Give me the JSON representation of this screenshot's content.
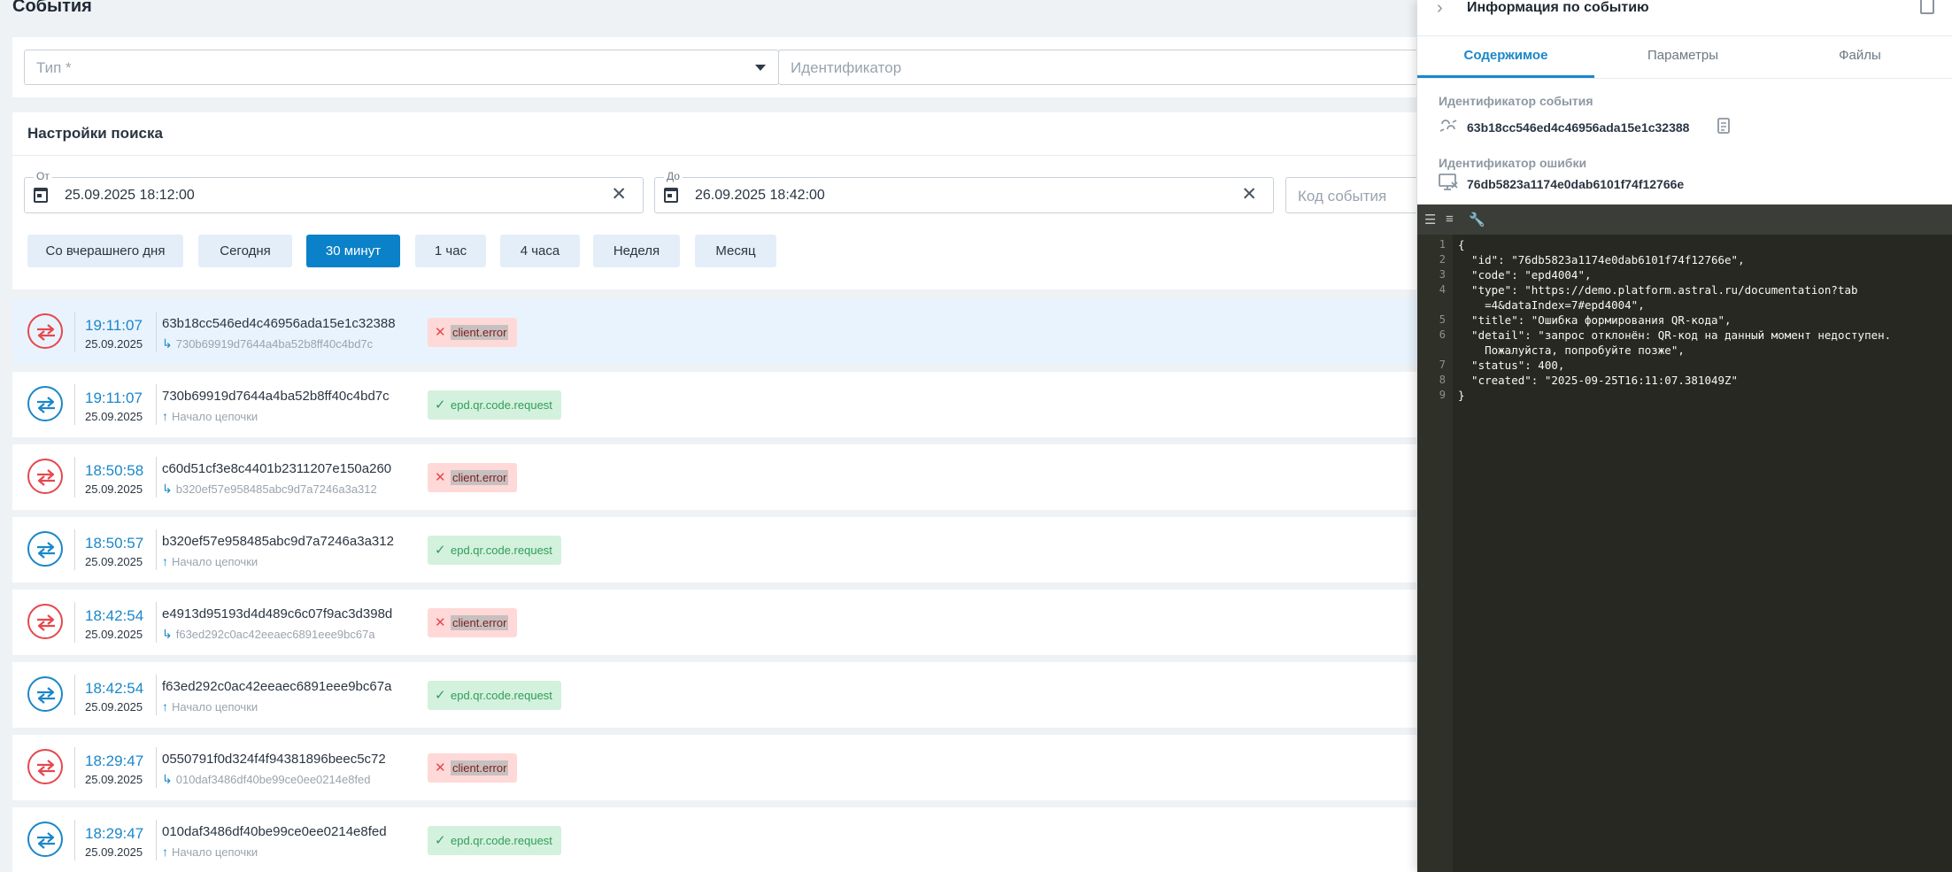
{
  "page": {
    "title": "События"
  },
  "filters": {
    "type_placeholder": "Тип *",
    "id_placeholder": "Идентификатор"
  },
  "search": {
    "title": "Настройки поиска",
    "from_label": "От",
    "from_value": "25.09.2025 18:12:00",
    "to_label": "До",
    "to_value": "26.09.2025 18:42:00",
    "code_placeholder": "Код события",
    "quick": [
      "Со вчерашнего дня",
      "Сегодня",
      "30 минут",
      "1 час",
      "4 часа",
      "Неделя",
      "Месяц"
    ],
    "active_quick": "30 минут"
  },
  "events": [
    {
      "status": "error",
      "time": "19:11:07",
      "date": "25.09.2025",
      "id": "63b18cc546ed4c46956ada15e1c32388",
      "sub": "730b69919d7644a4ba52b8ff40c4bd7c",
      "badge": "client.error"
    },
    {
      "status": "ok",
      "time": "19:11:07",
      "date": "25.09.2025",
      "id": "730b69919d7644a4ba52b8ff40c4bd7c",
      "sub": "Начало цепочки",
      "badge": "epd.qr.code.request"
    },
    {
      "status": "error",
      "time": "18:50:58",
      "date": "25.09.2025",
      "id": "c60d51cf3e8c4401b2311207e150a260",
      "sub": "b320ef57e958485abc9d7a7246a3a312",
      "badge": "client.error"
    },
    {
      "status": "ok",
      "time": "18:50:57",
      "date": "25.09.2025",
      "id": "b320ef57e958485abc9d7a7246a3a312",
      "sub": "Начало цепочки",
      "badge": "epd.qr.code.request"
    },
    {
      "status": "error",
      "time": "18:42:54",
      "date": "25.09.2025",
      "id": "e4913d95193d4d489c6c07f9ac3d398d",
      "sub": "f63ed292c0ac42eeaec6891eee9bc67a",
      "badge": "client.error"
    },
    {
      "status": "ok",
      "time": "18:42:54",
      "date": "25.09.2025",
      "id": "f63ed292c0ac42eeaec6891eee9bc67a",
      "sub": "Начало цепочки",
      "badge": "epd.qr.code.request"
    },
    {
      "status": "error",
      "time": "18:29:47",
      "date": "25.09.2025",
      "id": "0550791f0d324f4f94381896beec5c72",
      "sub": "010daf3486df40be99ce0ee0214e8fed",
      "badge": "client.error"
    },
    {
      "status": "ok",
      "time": "18:29:47",
      "date": "25.09.2025",
      "id": "010daf3486df40be99ce0ee0214e8fed",
      "sub": "Начало цепочки",
      "badge": "epd.qr.code.request"
    }
  ],
  "panel": {
    "title": "Информация по событию",
    "tabs": [
      "Содержимое",
      "Параметры",
      "Файлы"
    ],
    "event_id_label": "Идентификатор события",
    "event_id": "63b18cc546ed4c46956ada15e1c32388",
    "error_id_label": "Идентификатор ошибки",
    "error_id": "76db5823a1174e0dab6101f74f12766e",
    "code_lines": [
      "{",
      "  \"id\": \"76db5823a1174e0dab6101f74f12766e\",",
      "  \"code\": \"epd4004\",",
      "  \"type\": \"https://demo.platform.astral.ru/documentation?tab",
      "    =4&dataIndex=7#epd4004\",",
      "  \"title\": \"Ошибка формирования QR-кода\",",
      "  \"detail\": \"запрос отклонён: QR-код на данный момент недоступен.",
      "    Пожалуйста, попробуйте позже\",",
      "  \"status\": 400,",
      "  \"created\": \"2025-09-25T16:11:07.381049Z\"",
      "}"
    ],
    "line_numbers": [
      "1",
      "2",
      "3",
      "4",
      "",
      "5",
      "6",
      "",
      "7",
      "8",
      "9"
    ]
  },
  "colors": {
    "accent": "#0a81c8",
    "error": "#e5484d",
    "success": "#2f9e57",
    "editor_bg": "#272822"
  }
}
